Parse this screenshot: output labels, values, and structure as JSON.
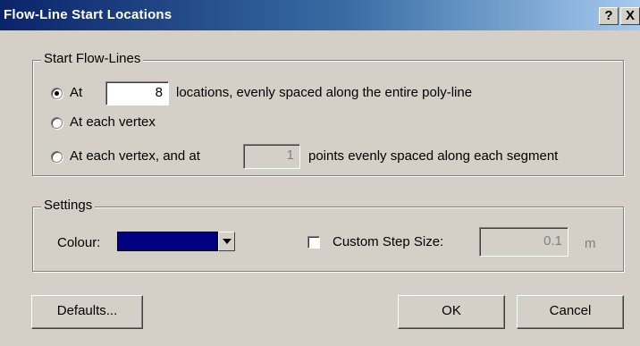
{
  "window": {
    "title": "Flow-Line Start Locations",
    "help_label": "?",
    "close_label": "X"
  },
  "start_group": {
    "legend": "Start Flow-Lines",
    "option1": {
      "prefix": "At",
      "value": "8",
      "suffix": "locations, evenly spaced along the entire poly-line",
      "selected": true
    },
    "option2": {
      "label": "At each vertex",
      "selected": false
    },
    "option3": {
      "prefix": "At each vertex, and at",
      "value": "1",
      "suffix": "points evenly spaced along each segment",
      "selected": false
    }
  },
  "settings_group": {
    "legend": "Settings",
    "colour_label": "Colour:",
    "colour_value": "#000080",
    "custom_step_label": "Custom Step Size:",
    "custom_step_checked": false,
    "step_value": "0.1",
    "step_unit": "m"
  },
  "buttons": {
    "defaults": "Defaults...",
    "ok": "OK",
    "cancel": "Cancel"
  }
}
